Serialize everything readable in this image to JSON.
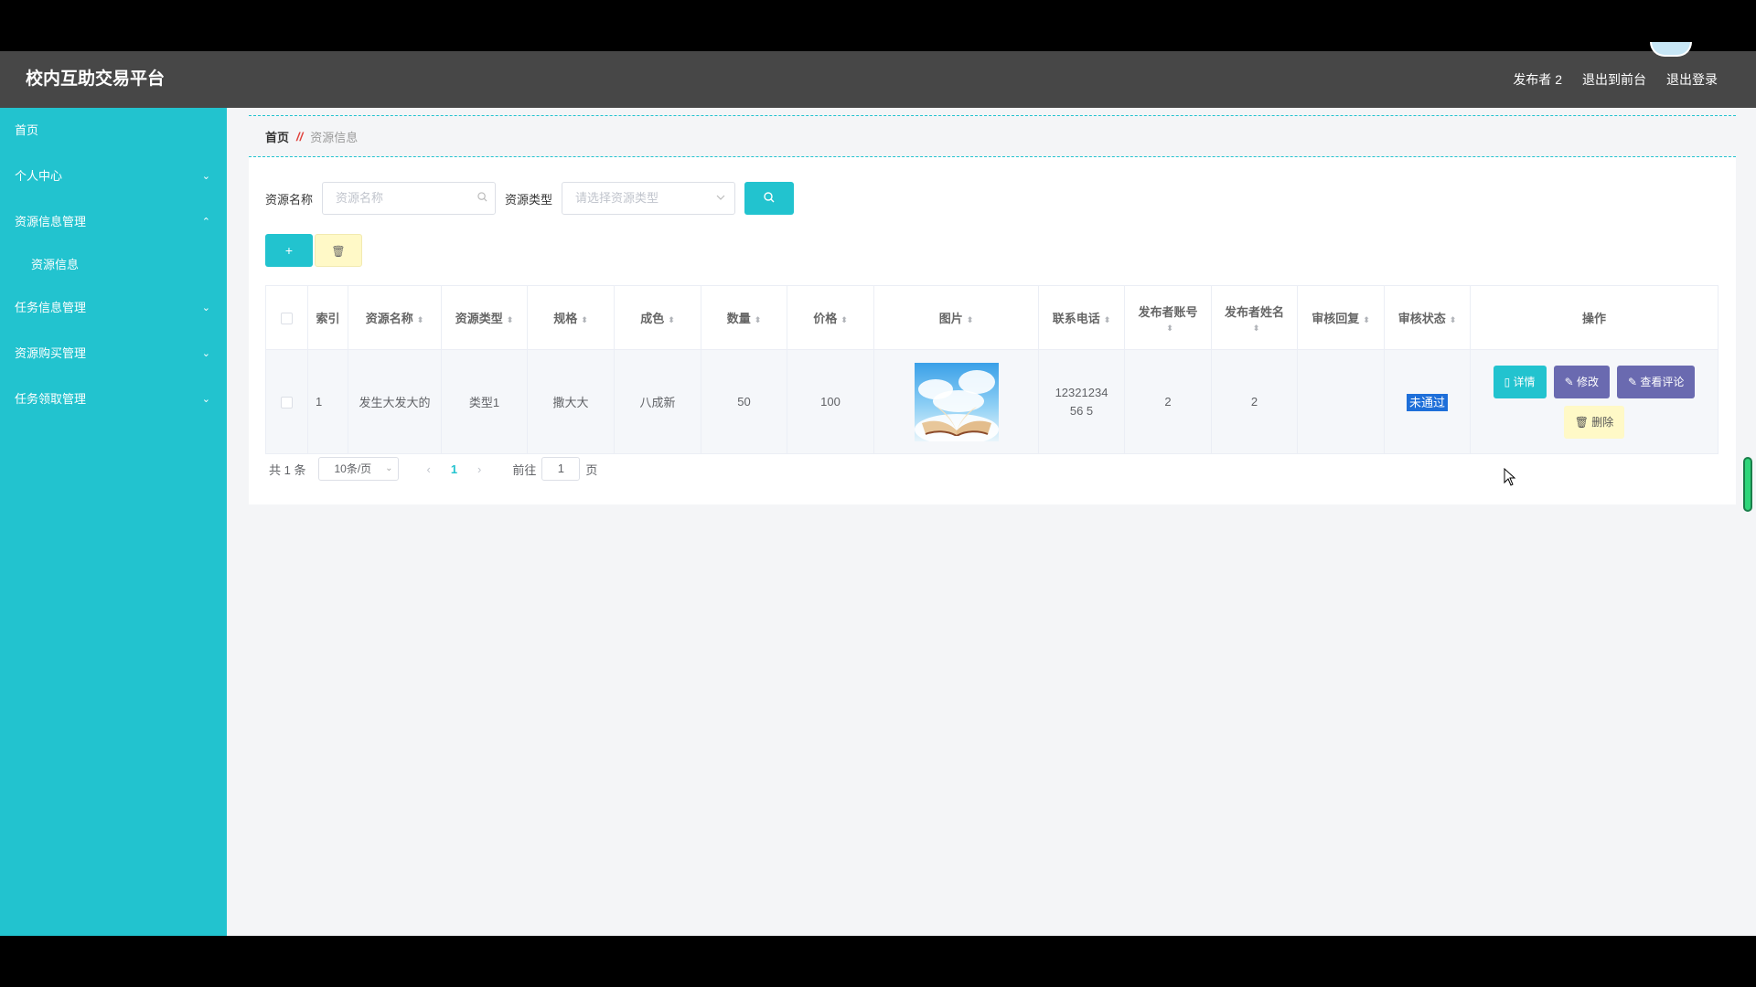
{
  "header": {
    "title": "校内互助交易平台",
    "user_label": "发布者 2",
    "to_front_label": "退出到前台",
    "logout_label": "退出登录"
  },
  "sidebar": {
    "items": [
      {
        "label": "首页",
        "expandable": false
      },
      {
        "label": "个人中心",
        "expandable": true,
        "chevron": "⌄"
      },
      {
        "label": "资源信息管理",
        "expandable": true,
        "chevron": "⌃"
      },
      {
        "label": "资源信息",
        "sub": true
      },
      {
        "label": "任务信息管理",
        "expandable": true,
        "chevron": "⌄"
      },
      {
        "label": "资源购买管理",
        "expandable": true,
        "chevron": "⌄"
      },
      {
        "label": "任务领取管理",
        "expandable": true,
        "chevron": "⌄"
      }
    ]
  },
  "breadcrumb": {
    "home": "首页",
    "separator": "//",
    "current": "资源信息"
  },
  "search": {
    "name_label": "资源名称",
    "name_placeholder": "资源名称",
    "type_label": "资源类型",
    "type_placeholder": "请选择资源类型",
    "search_icon": "search-icon"
  },
  "actions": {
    "add_label": "+",
    "delete_icon": "🗑"
  },
  "table": {
    "columns": [
      "索引",
      "资源名称",
      "资源类型",
      "规格",
      "成色",
      "数量",
      "价格",
      "图片",
      "联系电话",
      "发布者账号",
      "发布者姓名",
      "审核回复",
      "审核状态",
      "操作"
    ],
    "sort_icon": "⬍",
    "rows": [
      {
        "index": "1",
        "name": "发生大发大的",
        "type": "类型1",
        "spec": "撒大大",
        "condition": "八成新",
        "quantity": "50",
        "price": "100",
        "image": "book-in-sky-image",
        "phone": "1232123456 5",
        "publisher_account": "2",
        "publisher_name": "2",
        "review_reply": "",
        "review_status": "未通过",
        "ops": {
          "detail": "详情",
          "edit": "修改",
          "comment": "查看评论",
          "delete": "删除"
        }
      }
    ]
  },
  "pager": {
    "total": "共 1 条",
    "page_size": "10条/页",
    "current_page": "1",
    "goto_label": "前往",
    "goto_value": "1",
    "page_suffix": "页"
  },
  "colors": {
    "accent": "#22c3cf",
    "header_bg": "#474747",
    "purple_btn": "#6a6ab0",
    "yellow_btn": "#fff9c7"
  }
}
